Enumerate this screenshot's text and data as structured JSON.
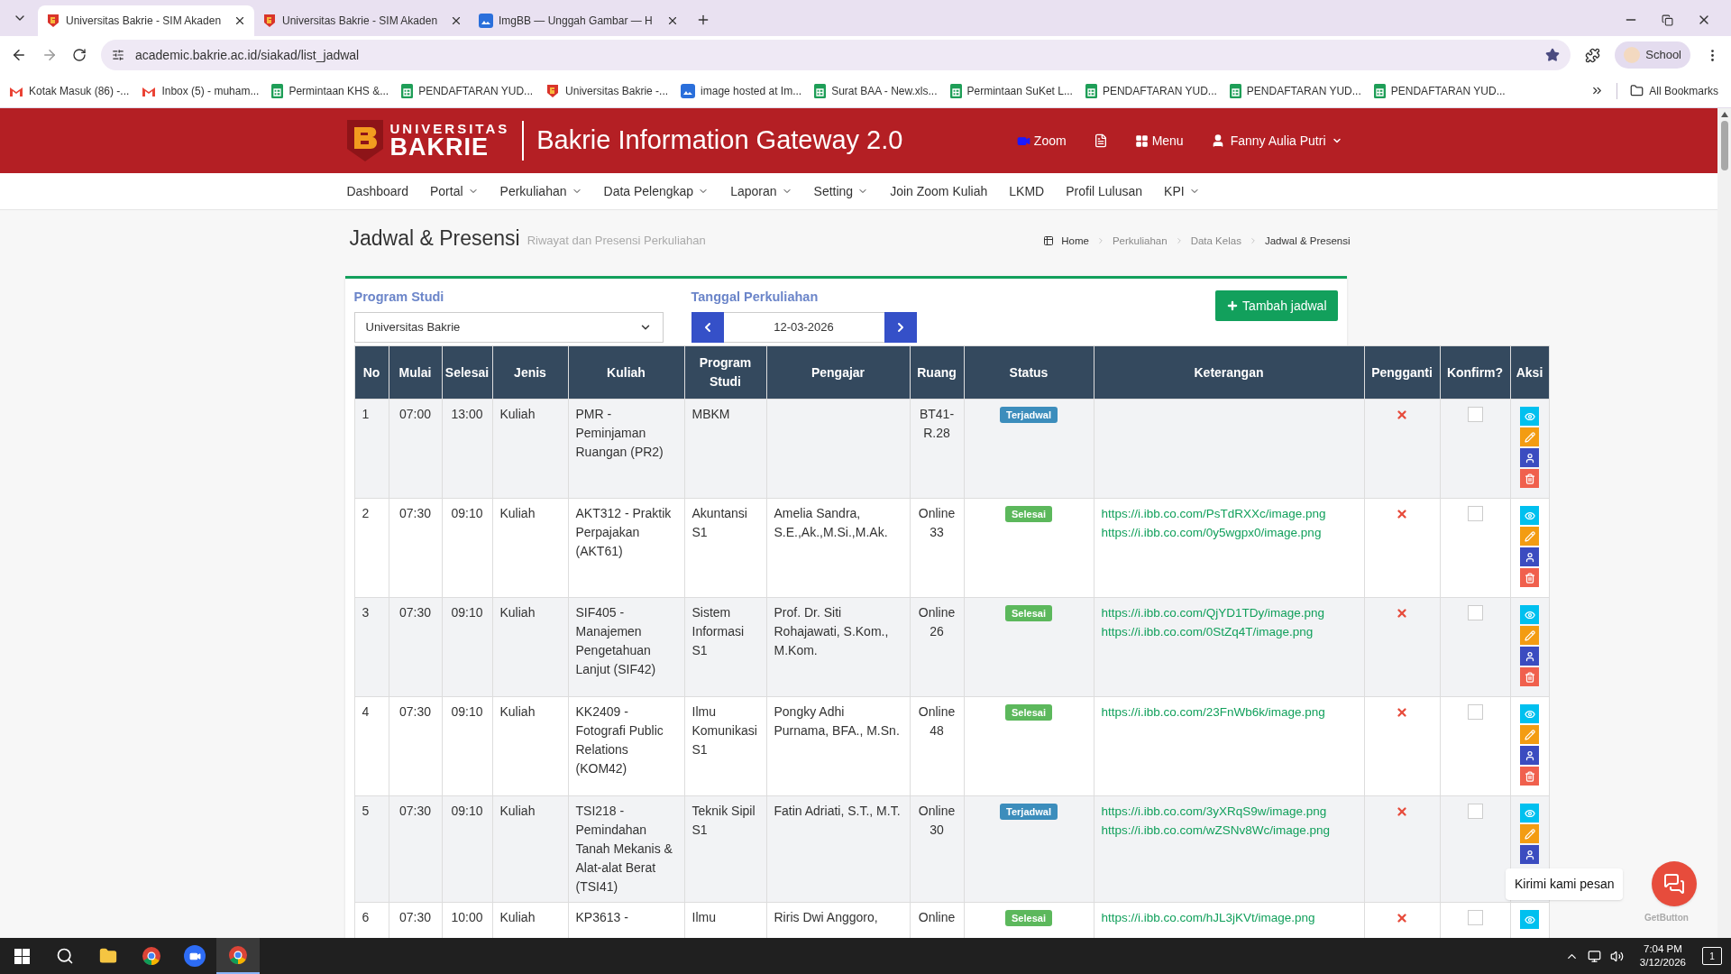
{
  "browser": {
    "tabs": [
      {
        "title": "Universitas Bakrie - SIM Akaden",
        "kind": "bakrie",
        "selected": true
      },
      {
        "title": "Universitas Bakrie - SIM Akaden",
        "kind": "bakrie",
        "selected": false
      },
      {
        "title": "ImgBB — Unggah Gambar — H",
        "kind": "ibb",
        "selected": false
      }
    ],
    "url": "academic.bakrie.ac.id/siakad/list_jadwal",
    "profile": "School",
    "bookmarks": [
      {
        "title": "Kotak Masuk (86) -...",
        "kind": "gmail"
      },
      {
        "title": "Inbox (5) - muham...",
        "kind": "gmail"
      },
      {
        "title": "Permintaan KHS &...",
        "kind": "sheets"
      },
      {
        "title": "PENDAFTARAN YUD...",
        "kind": "sheets"
      },
      {
        "title": "Universitas Bakrie -...",
        "kind": "bakrie"
      },
      {
        "title": "image hosted at Im...",
        "kind": "ibb"
      },
      {
        "title": "Surat BAA - New.xls...",
        "kind": "sheets"
      },
      {
        "title": "Permintaan SuKet L...",
        "kind": "sheets"
      },
      {
        "title": "PENDAFTARAN YUD...",
        "kind": "sheets"
      },
      {
        "title": "PENDAFTARAN YUD...",
        "kind": "sheets"
      },
      {
        "title": "PENDAFTARAN YUD...",
        "kind": "sheets"
      }
    ],
    "all_bookmarks": "All Bookmarks"
  },
  "header": {
    "logo_top": "UNIVERSITAS",
    "logo_bottom": "BAKRIE",
    "title": "Bakrie Information Gateway 2.0",
    "zoom": "Zoom",
    "menu": "Menu",
    "user": "Fanny Aulia Putri"
  },
  "nav": [
    {
      "label": "Dashboard",
      "dropdown": false
    },
    {
      "label": "Portal",
      "dropdown": true
    },
    {
      "label": "Perkuliahan",
      "dropdown": true
    },
    {
      "label": "Data Pelengkap",
      "dropdown": true
    },
    {
      "label": "Laporan",
      "dropdown": true
    },
    {
      "label": "Setting",
      "dropdown": true
    },
    {
      "label": "Join Zoom Kuliah",
      "dropdown": false
    },
    {
      "label": "LKMD",
      "dropdown": false
    },
    {
      "label": "Profil Lulusan",
      "dropdown": false
    },
    {
      "label": "KPI",
      "dropdown": true
    }
  ],
  "page": {
    "title": "Jadwal & Presensi",
    "subtitle": "Riwayat dan Presensi Perkuliahan",
    "breadcrumb": [
      "Home",
      "Perkuliahan",
      "Data Kelas",
      "Jadwal & Presensi"
    ]
  },
  "filters": {
    "program_label": "Program Studi",
    "program_value": "Universitas Bakrie",
    "date_label": "Tanggal Perkuliahan",
    "date_value": "12-03-2026",
    "add_button": "Tambah jadwal"
  },
  "table": {
    "columns": [
      "No",
      "Mulai",
      "Selesai",
      "Jenis",
      "Kuliah",
      "Program Studi",
      "Pengajar",
      "Ruang",
      "Status",
      "Keterangan",
      "Pengganti",
      "Konfirm?",
      "Aksi"
    ],
    "rows": [
      {
        "no": "1",
        "start": "07:00",
        "end": "13:00",
        "type": "Kuliah",
        "course": "PMR - Peminjaman Ruangan (PR2)",
        "program": "MBKM",
        "room": "BT41-R.28",
        "status": {
          "label": "Terjadwal",
          "kind": "scheduled"
        },
        "substitute": false,
        "confirmed": false,
        "actions": [
          {
            "kind": "view"
          },
          {
            "kind": "edit"
          },
          {
            "kind": "assign"
          },
          {
            "kind": "delete"
          }
        ]
      },
      {
        "no": "2",
        "start": "07:30",
        "end": "09:10",
        "type": "Kuliah",
        "course": "AKT312 - Praktik Perpajakan (AKT61)",
        "program": "Akuntansi S1",
        "lecturer": "Amelia Sandra, S.E.,Ak.,M.Si.,M.Ak.",
        "room": "Online 33",
        "status": {
          "label": "Selesai",
          "kind": "done"
        },
        "links": [
          "https://i.ibb.co.com/PsTdRXXc/image.png",
          "https://i.ibb.co.com/0y5wgpx0/image.png"
        ],
        "substitute": false,
        "confirmed": false,
        "actions": [
          {
            "kind": "view"
          },
          {
            "kind": "edit"
          },
          {
            "kind": "assign"
          },
          {
            "kind": "delete"
          }
        ]
      },
      {
        "no": "3",
        "start": "07:30",
        "end": "09:10",
        "type": "Kuliah",
        "course": "SIF405 - Manajemen Pengetahuan Lanjut (SIF42)",
        "program": "Sistem Informasi S1",
        "lecturer": "Prof. Dr. Siti Rohajawati, S.Kom., M.Kom.",
        "room": "Online 26",
        "status": {
          "label": "Selesai",
          "kind": "done"
        },
        "links": [
          "https://i.ibb.co.com/QjYD1TDy/image.png",
          "https://i.ibb.co.com/0StZq4T/image.png"
        ],
        "substitute": false,
        "confirmed": false,
        "actions": [
          {
            "kind": "view"
          },
          {
            "kind": "edit"
          },
          {
            "kind": "assign"
          },
          {
            "kind": "delete"
          }
        ]
      },
      {
        "no": "4",
        "start": "07:30",
        "end": "09:10",
        "type": "Kuliah",
        "course": "KK2409 - Fotografi Public Relations (KOM42)",
        "program": "Ilmu Komunikasi S1",
        "lecturer": "Pongky Adhi Purnama, BFA., M.Sn.",
        "room": "Online 48",
        "status": {
          "label": "Selesai",
          "kind": "done"
        },
        "links": [
          "https://i.ibb.co.com/23FnWb6k/image.png"
        ],
        "substitute": false,
        "confirmed": false,
        "actions": [
          {
            "kind": "view"
          },
          {
            "kind": "edit"
          },
          {
            "kind": "assign"
          },
          {
            "kind": "delete"
          }
        ]
      },
      {
        "no": "5",
        "start": "07:30",
        "end": "09:10",
        "type": "Kuliah",
        "course": "TSI218 - Pemindahan Tanah Mekanis & Alat-alat Berat (TSI41)",
        "program": "Teknik Sipil S1",
        "lecturer": "Fatin Adriati, S.T., M.T.",
        "room": "Online 30",
        "status": {
          "label": "Terjadwal",
          "kind": "scheduled"
        },
        "links": [
          "https://i.ibb.co.com/3yXRqS9w/image.png",
          "https://i.ibb.co.com/wZSNv8Wc/image.png"
        ],
        "substitute": false,
        "confirmed": false,
        "actions": [
          {
            "kind": "view"
          },
          {
            "kind": "edit"
          },
          {
            "kind": "assign"
          }
        ]
      },
      {
        "no": "6",
        "start": "07:30",
        "end": "10:00",
        "type": "Kuliah",
        "course": "KP3613 -",
        "program": "Ilmu",
        "lecturer": "Riris Dwi Anggoro,",
        "room": "Online",
        "status": {
          "label": "Selesai",
          "kind": "done"
        },
        "links": [
          "https://i.ibb.co.com/hJL3jKVt/image.png"
        ],
        "substitute": false,
        "confirmed": false,
        "actions": [
          {
            "kind": "view"
          }
        ]
      }
    ]
  },
  "chat": {
    "tooltip": "Kirimi kami pesan",
    "brand": "GetButton"
  },
  "taskbar": {
    "time": "7:04 PM",
    "date": "3/12/2026",
    "notifications": "1"
  }
}
